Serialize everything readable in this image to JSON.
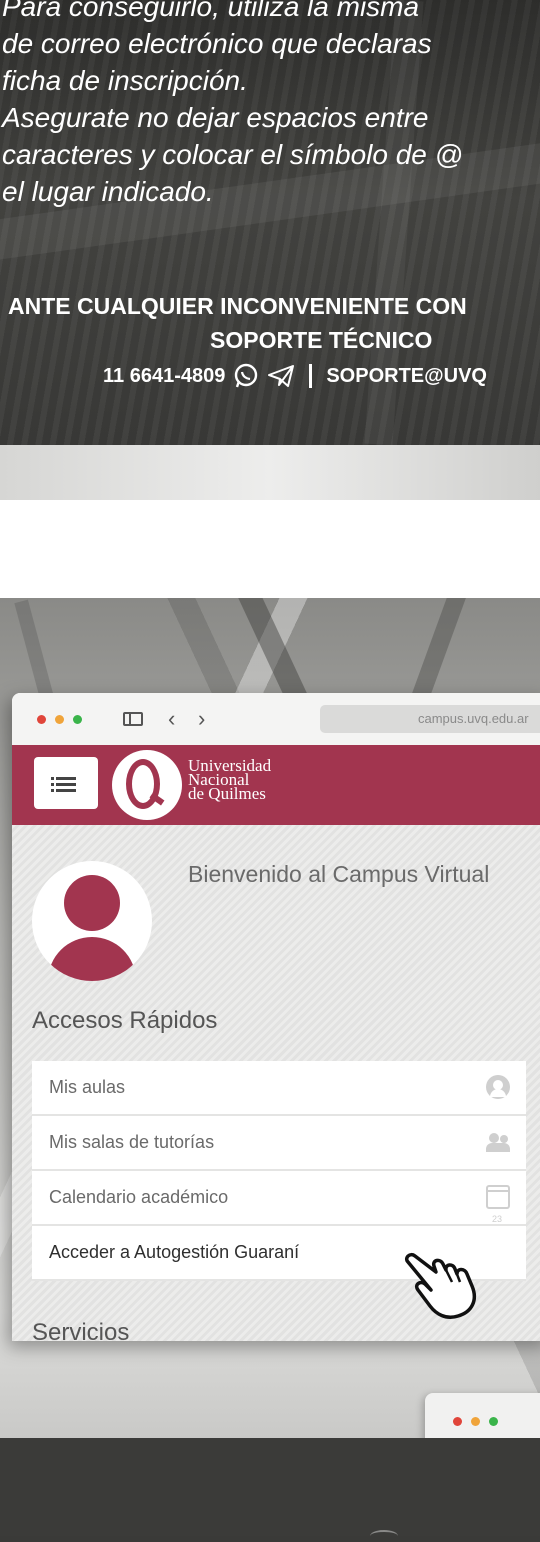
{
  "intro": {
    "lines": [
      "Para conseguirlo, utilizá la misma",
      "de correo electrónico que declaras",
      "ficha de inscripción.",
      "Asegurate no dejar espacios entre",
      "caracteres y colocar el símbolo de @",
      "el lugar indicado."
    ]
  },
  "support": {
    "line1": "ANTE CUALQUIER INCONVENIENTE CON",
    "line2": "SOPORTE TÉCNICO",
    "phone": "11 6641-4809",
    "email": "SOPORTE@UVQ"
  },
  "browser": {
    "url": "campus.uvq.edu.ar",
    "university": [
      "Universidad",
      "Nacional",
      "de Quilmes"
    ],
    "welcome": "Bienvenido al Campus Virtual",
    "quick_access_title": "Accesos Rápidos",
    "quick_access": [
      {
        "label": "Mis aulas",
        "icon": "user-circle-icon"
      },
      {
        "label": "Mis salas de tutorías",
        "icon": "users-icon"
      },
      {
        "label": "Calendario académico",
        "icon": "calendar-icon"
      },
      {
        "label": "Acceder a Autogestión Guaraní",
        "icon": ""
      }
    ],
    "services_title": "Servicios"
  },
  "colors": {
    "brand": "#a2354f",
    "dark_bg": "#3a3a38"
  }
}
